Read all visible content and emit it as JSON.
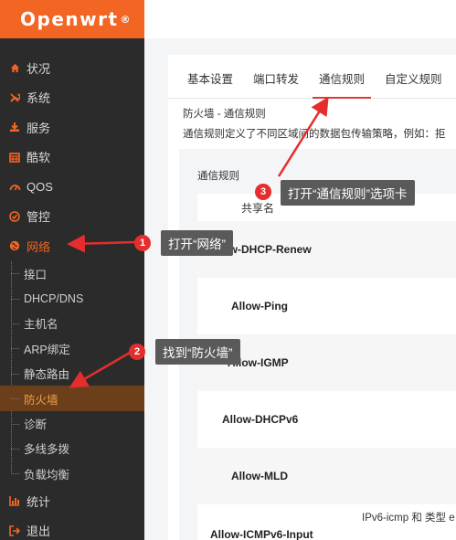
{
  "brand": {
    "name": "Openwrt",
    "mark": "®"
  },
  "sidebar": {
    "items": [
      {
        "label": "状况",
        "icon": "home-icon"
      },
      {
        "label": "系统",
        "icon": "wrench-icon"
      },
      {
        "label": "服务",
        "icon": "download-icon"
      },
      {
        "label": "酷软",
        "icon": "calendar-icon"
      },
      {
        "label": "QOS",
        "icon": "gauge-icon"
      },
      {
        "label": "管控",
        "icon": "check-circle-icon"
      },
      {
        "label": "网络",
        "icon": "globe-icon"
      }
    ],
    "network_sub": [
      "接口",
      "DHCP/DNS",
      "主机名",
      "ARP绑定",
      "静态路由",
      "防火墙",
      "诊断",
      "多线多拨",
      "负载均衡"
    ],
    "bottom_items": [
      {
        "label": "统计",
        "icon": "bar-chart-icon"
      },
      {
        "label": "退出",
        "icon": "logout-icon"
      }
    ]
  },
  "tabs": [
    "基本设置",
    "端口转发",
    "通信规则",
    "自定义规则"
  ],
  "section": {
    "title": "防火墙 - 通信规则",
    "description": "通信规则定义了不同区域间的数据包传输策略，例如：拒"
  },
  "table": {
    "panel_title": "通信规则",
    "header": "共享名",
    "rows": [
      "Allow-DHCP-Renew",
      "Allow-Ping",
      "Allow-IGMP",
      "Allow-DHCPv6",
      "Allow-MLD",
      "Allow-ICMPv6-Input"
    ],
    "footer_text": "IPv6-icmp 和 类型 e"
  },
  "annotations": [
    {
      "num": "1",
      "text": "打开“网络”"
    },
    {
      "num": "2",
      "text": "找到“防火墙”"
    },
    {
      "num": "3",
      "text": "打开“通信规则”选项卡"
    }
  ],
  "colors": {
    "accent": "#f26522",
    "sidebar_bg": "#2b2b2b",
    "tab_underline": "#e03a2f",
    "callout_bg": "#5a5a5a",
    "badge": "#e52d2d"
  }
}
